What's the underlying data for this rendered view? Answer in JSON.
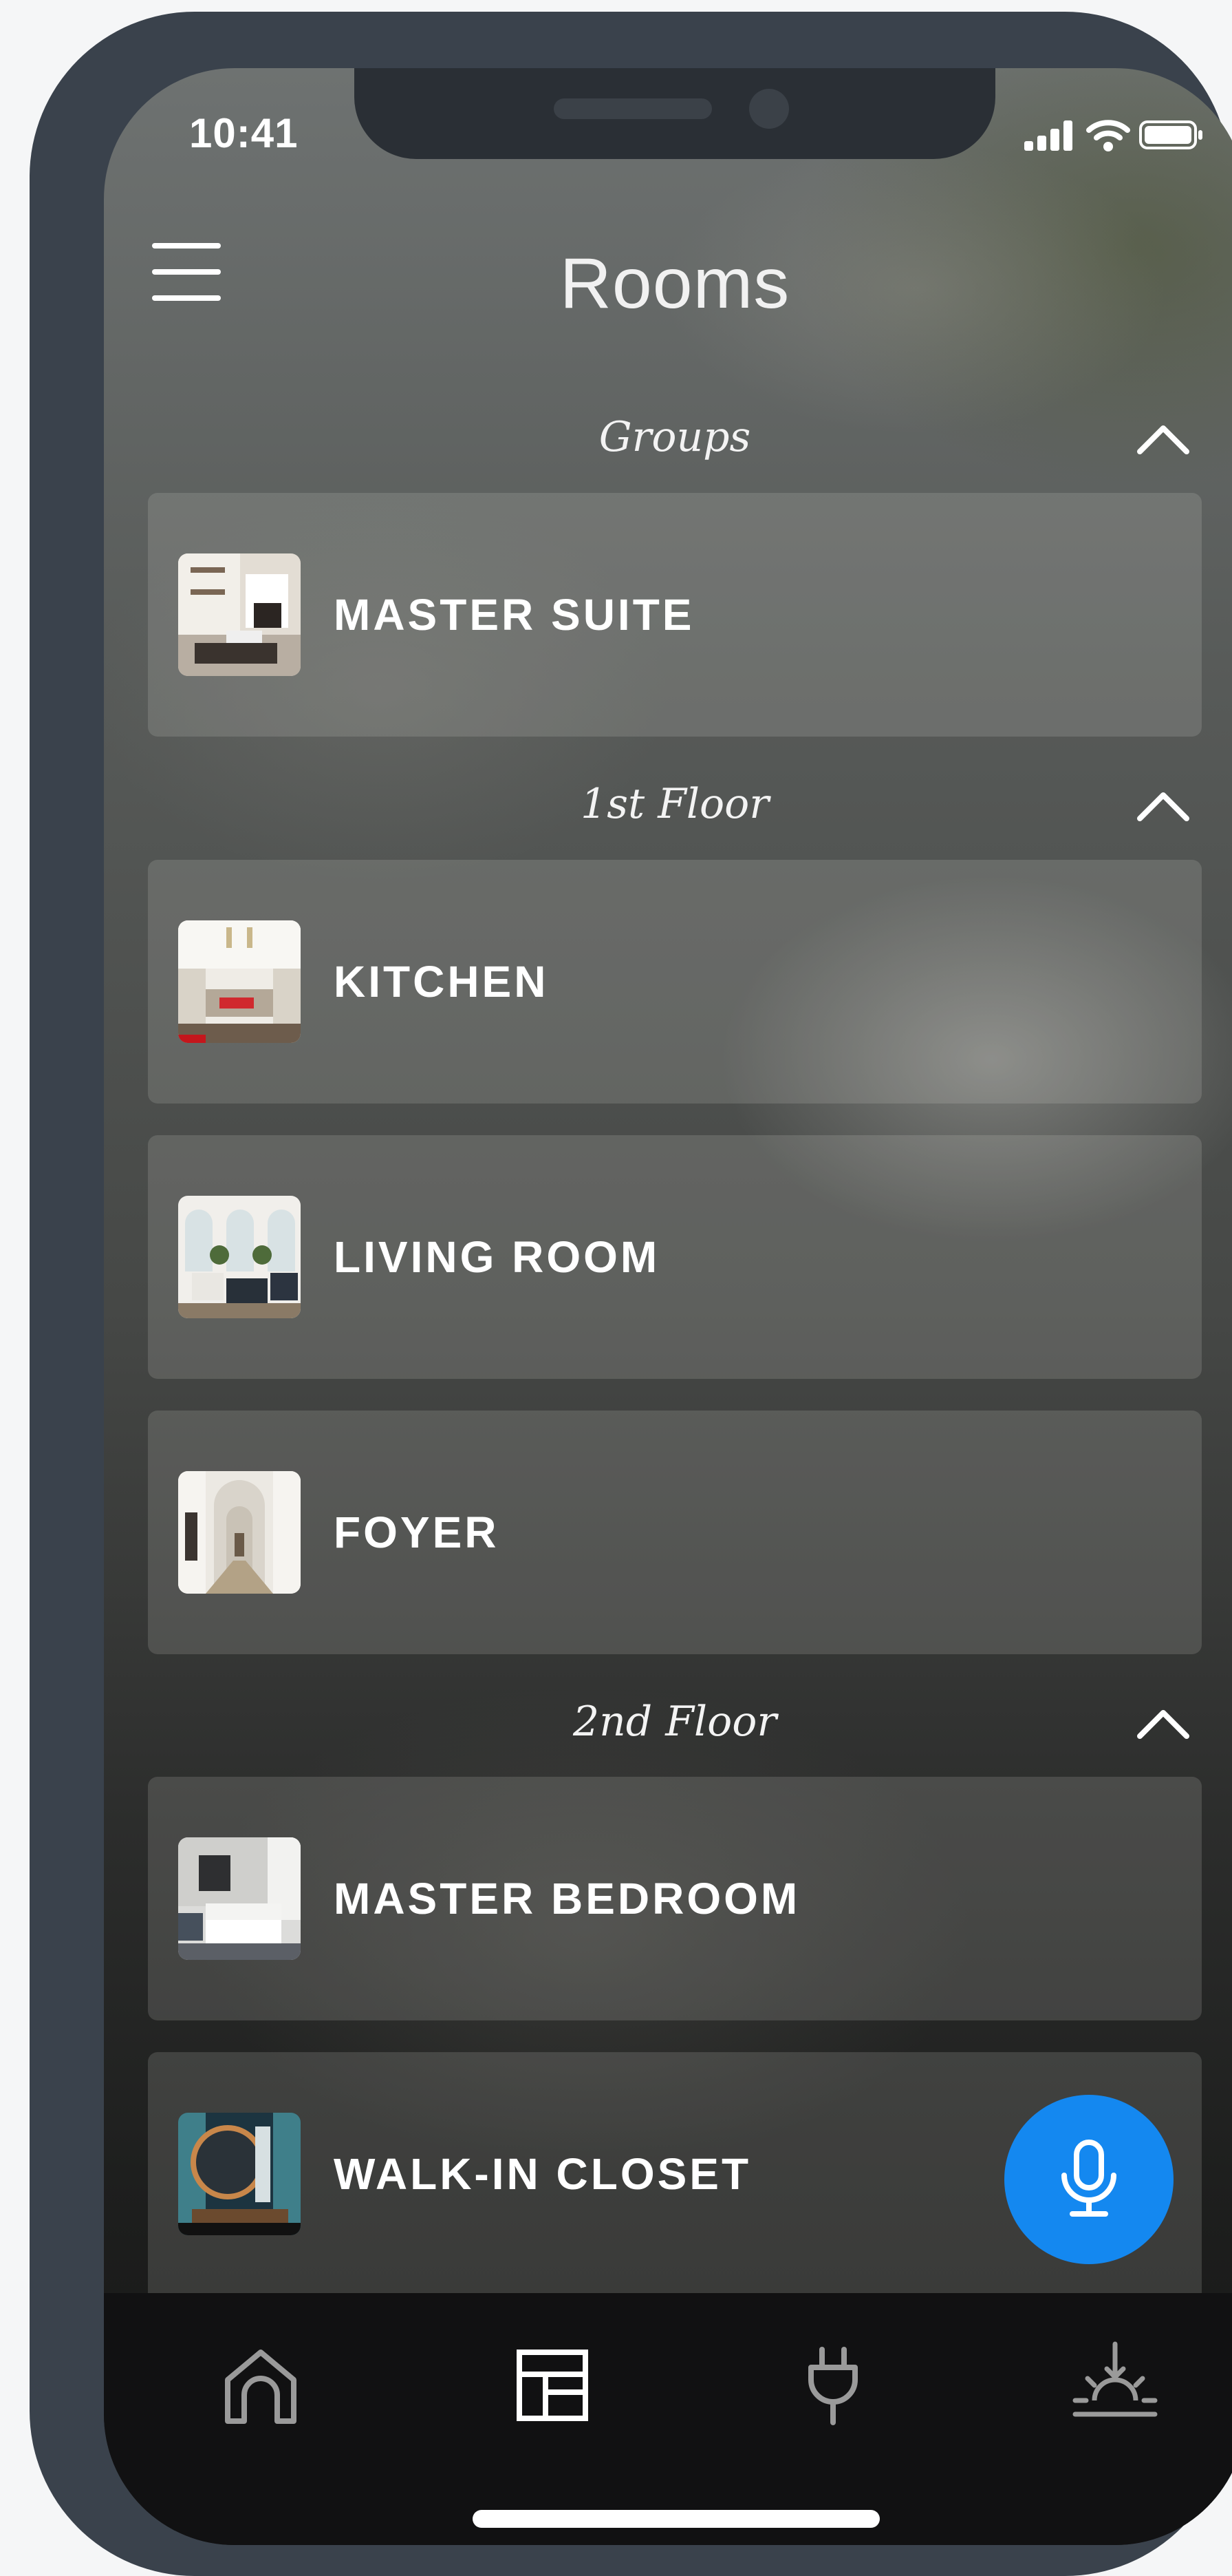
{
  "status_bar": {
    "time": "10:41"
  },
  "header": {
    "title": "Rooms"
  },
  "sections": [
    {
      "title": "Groups",
      "rooms": [
        {
          "name": "MASTER SUITE"
        }
      ]
    },
    {
      "title": "1st Floor",
      "rooms": [
        {
          "name": "KITCHEN"
        },
        {
          "name": "LIVING ROOM"
        },
        {
          "name": "FOYER"
        }
      ]
    },
    {
      "title": "2nd Floor",
      "rooms": [
        {
          "name": "MASTER BEDROOM"
        },
        {
          "name": "WALK-IN CLOSET"
        }
      ]
    }
  ],
  "tabbar": {
    "tabs": [
      {
        "icon": "home-icon",
        "selected": false
      },
      {
        "icon": "rooms-icon",
        "selected": true
      },
      {
        "icon": "plug-icon",
        "selected": false
      },
      {
        "icon": "scenes-icon",
        "selected": false
      }
    ]
  },
  "colors": {
    "accent": "#1488f0",
    "device": "#3a424c",
    "tabbar": "#111112"
  }
}
